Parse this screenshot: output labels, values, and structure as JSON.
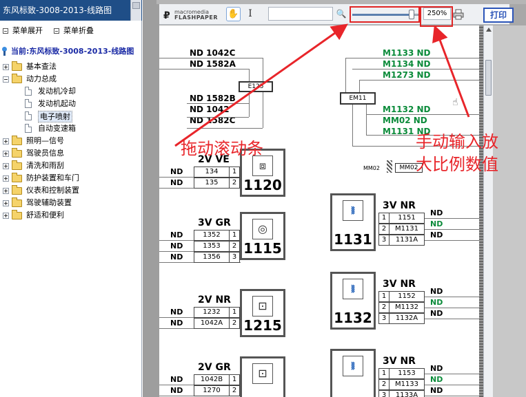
{
  "sidebar": {
    "title": "东风标致-3008-2013-线路图",
    "expand_label": "菜单展开",
    "collapse_label": "菜单折叠",
    "root_label": "当前:东风标致-3008-2013-线路图",
    "folders": [
      "基本查法",
      "动力总成",
      "照明—信号",
      "驾驶员信息",
      "清洗和雨刮",
      "防护装置和车门",
      "仪表和控制装置",
      "驾驶辅助装置",
      "舒适和便利"
    ],
    "children": [
      "发动机冷却",
      "发动机起动",
      "电子喷射",
      "自动变速箱"
    ],
    "selected_child": "电子喷射"
  },
  "toolbar": {
    "logo_small": "macromedia",
    "logo_big": "FLASHPAPER",
    "zoom_value": "250%",
    "zoom_fraction": 0.9,
    "print_label": "打印",
    "search_placeholder": ""
  },
  "annotations": {
    "left_text": "拖动滚动条",
    "right_text_1": "手动输入放",
    "right_text_2": "大比例数值",
    "color": "#e8252a"
  },
  "schematic": {
    "wires_left": [
      "ND 1042C",
      "ND 1582A",
      "ND 1582B",
      "ND 1042",
      "ND 1582C"
    ],
    "em_left": "E125",
    "wires_right": [
      "M1133 ND",
      "M1134 ND",
      "M1273 ND",
      "M1132 ND",
      "MM02 ND",
      "M1131 ND"
    ],
    "em_right": "EM11",
    "mm02_label": "MM02",
    "mm02_box": "MM02",
    "nd": "ND",
    "components_left": [
      {
        "title": "2V VE",
        "rows": [
          "134",
          "135"
        ],
        "num": "1120"
      },
      {
        "title": "3V GR",
        "rows": [
          "1352",
          "1353",
          "1356"
        ],
        "num": "1115"
      },
      {
        "title": "2V NR",
        "rows": [
          "1232",
          "1042A"
        ],
        "num": "1215"
      },
      {
        "title": "2V GR",
        "rows": [
          "1042B",
          "1270"
        ],
        "num": ""
      }
    ],
    "components_right": [
      {
        "title": "3V NR",
        "rows": [
          "1151",
          "M1131",
          "1131A"
        ],
        "num": "1131"
      },
      {
        "title": "3V NR",
        "rows": [
          "1152",
          "M1132",
          "1132A"
        ],
        "num": "1132"
      },
      {
        "title": "3V NR",
        "rows": [
          "1153",
          "M1133",
          "1133A"
        ],
        "num": ""
      }
    ]
  }
}
